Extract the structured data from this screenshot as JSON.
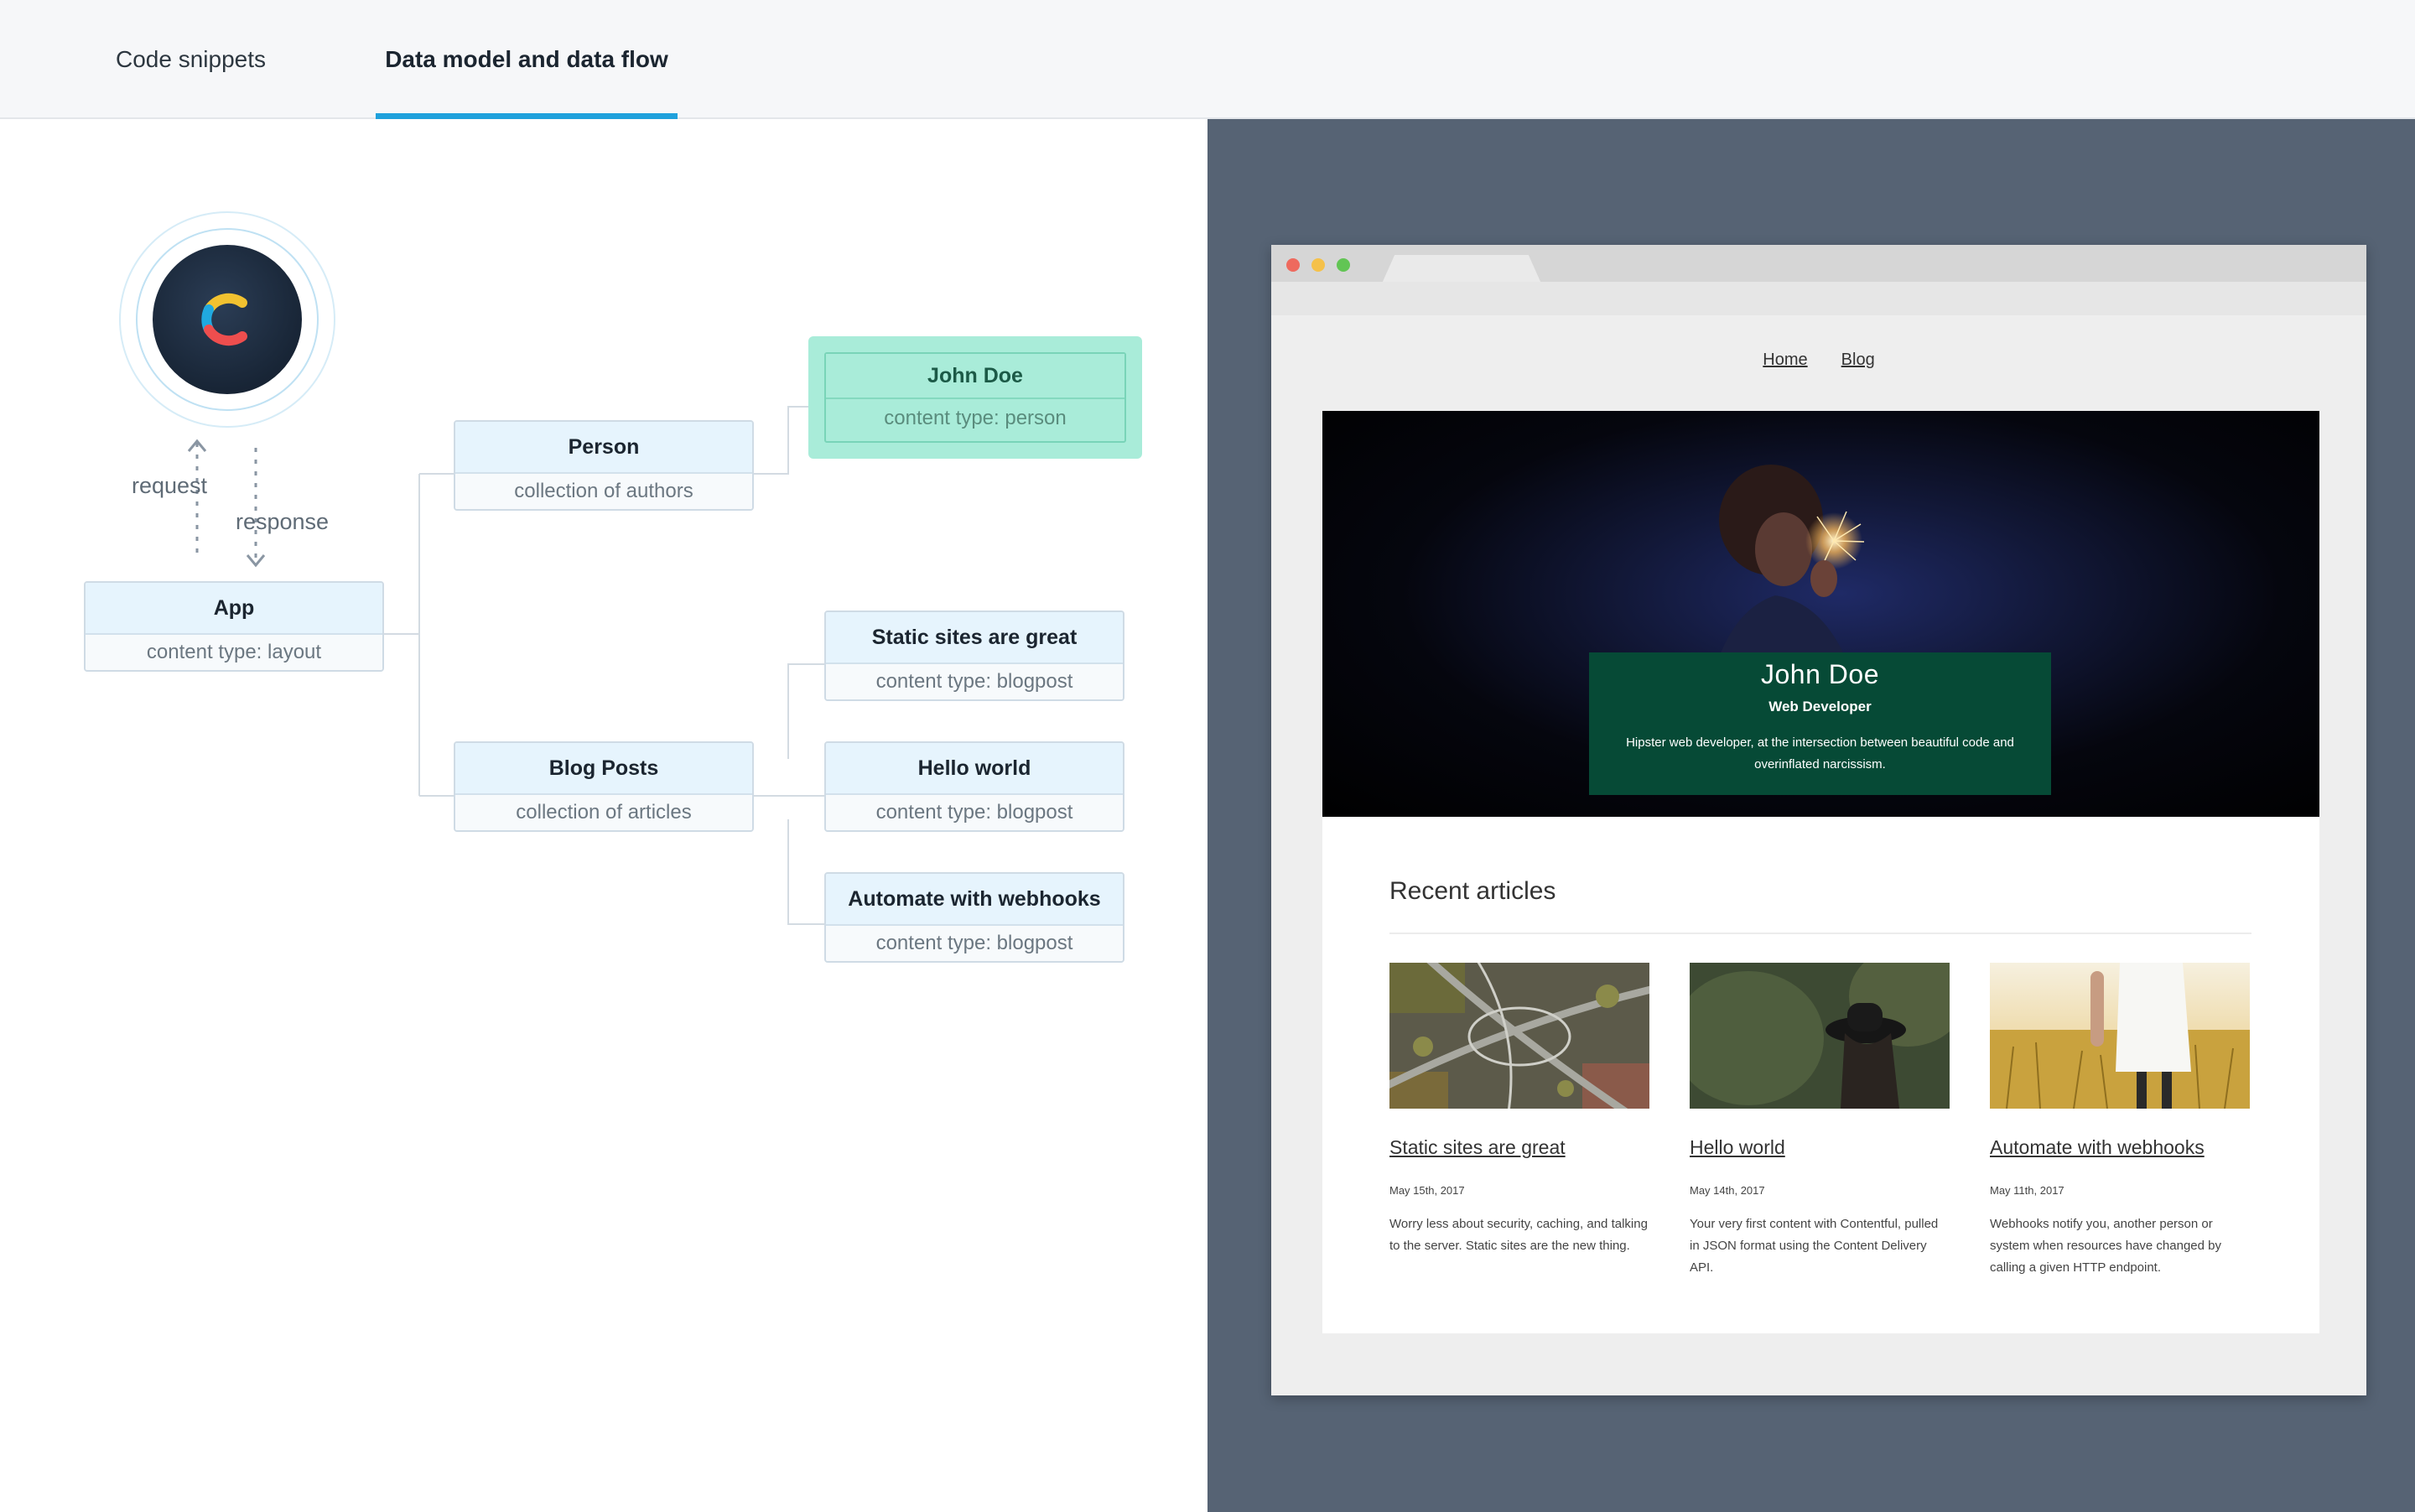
{
  "tabs": [
    {
      "label": "Code snippets",
      "active": false
    },
    {
      "label": "Data model and data flow",
      "active": true
    }
  ],
  "diagram": {
    "logo": "contentful-logo",
    "flow": {
      "request_label": "request",
      "response_label": "response"
    },
    "nodes": {
      "app": {
        "title": "App",
        "subtitle": "content type: layout"
      },
      "person": {
        "title": "Person",
        "subtitle": "collection of authors"
      },
      "blog_posts": {
        "title": "Blog Posts",
        "subtitle": "collection of articles"
      },
      "john_doe": {
        "title": "John Doe",
        "subtitle": "content type: person",
        "highlighted": true
      },
      "static_sites": {
        "title": "Static sites are great",
        "subtitle": "content type: blogpost"
      },
      "hello_world": {
        "title": "Hello world",
        "subtitle": "content type: blogpost"
      },
      "webhooks": {
        "title": "Automate with webhooks",
        "subtitle": "content type: blogpost"
      }
    },
    "colors": {
      "highlight": "#a9ecd9",
      "node_header": "#e6f4fd",
      "tab_accent": "#1fa1dc"
    }
  },
  "preview": {
    "nav": [
      "Home",
      "Blog"
    ],
    "hero": {
      "name": "John Doe",
      "role": "Web Developer",
      "description": "Hipster web developer, at the intersection between beautiful code and overinflated narcissism."
    },
    "recent_title": "Recent articles",
    "articles": [
      {
        "title": "Static sites are great",
        "date": "May 15th, 2017",
        "summary": "Worry less about security, caching, and talking to the server. Static sites are the new thing.",
        "image": "highway-aerial-photo"
      },
      {
        "title": "Hello world",
        "date": "May 14th, 2017",
        "summary": "Your very first content with Contentful, pulled in JSON format using the Content Delivery API.",
        "image": "woman-in-hat-forest-photo"
      },
      {
        "title": "Automate with webhooks",
        "date": "May 11th, 2017",
        "summary": "Webhooks notify you, another person or system when resources have changed by calling a given HTTP endpoint.",
        "image": "wheat-field-photo"
      }
    ]
  }
}
